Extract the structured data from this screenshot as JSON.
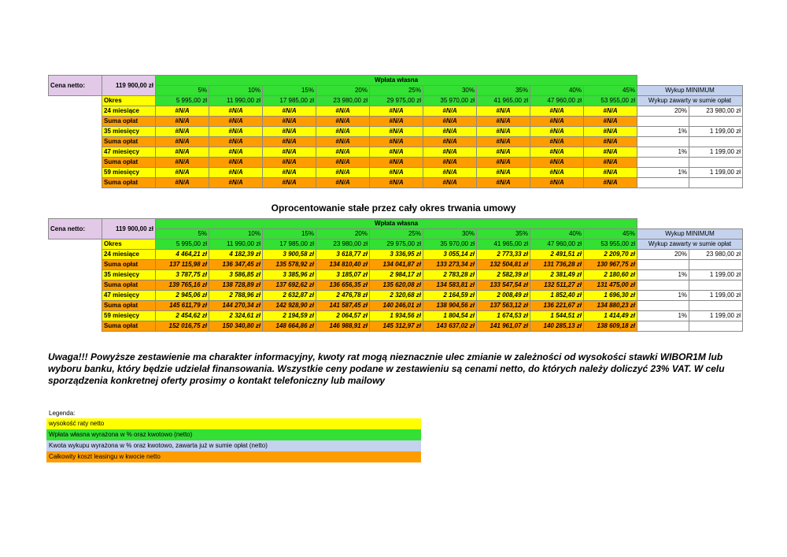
{
  "table1": {
    "cena_label": "Cena netto:",
    "cena_value": "119 900,00 zł",
    "wplata_title": "Wpłata własna",
    "percents": [
      "5%",
      "10%",
      "15%",
      "20%",
      "25%",
      "30%",
      "35%",
      "40%",
      "45%"
    ],
    "okres_label": "Okres",
    "amounts": [
      "5 995,00 zł",
      "11 990,00 zł",
      "17 985,00 zł",
      "23 980,00 zł",
      "29 975,00 zł",
      "35 970,00 zł",
      "41 965,00 zł",
      "47 960,00 zł",
      "53 955,00 zł"
    ],
    "wykup_title": "Wykup MINIMUM",
    "wykup_sub": "Wykup zawarty w sumie opłat",
    "rows": [
      {
        "label": "24 miesiące",
        "type": "rate",
        "cells": [
          "#N/A",
          "#N/A",
          "#N/A",
          "#N/A",
          "#N/A",
          "#N/A",
          "#N/A",
          "#N/A",
          "#N/A"
        ],
        "pct": "20%",
        "amt": "23 980,00 zł"
      },
      {
        "label": "Suma opłat",
        "type": "sum",
        "cells": [
          "#N/A",
          "#N/A",
          "#N/A",
          "#N/A",
          "#N/A",
          "#N/A",
          "#N/A",
          "#N/A",
          "#N/A"
        ],
        "pct": "",
        "amt": ""
      },
      {
        "label": "35 miesięcy",
        "type": "rate",
        "cells": [
          "#N/A",
          "#N/A",
          "#N/A",
          "#N/A",
          "#N/A",
          "#N/A",
          "#N/A",
          "#N/A",
          "#N/A"
        ],
        "pct": "1%",
        "amt": "1 199,00 zł"
      },
      {
        "label": "Suma opłat",
        "type": "sum",
        "cells": [
          "#N/A",
          "#N/A",
          "#N/A",
          "#N/A",
          "#N/A",
          "#N/A",
          "#N/A",
          "#N/A",
          "#N/A"
        ],
        "pct": "",
        "amt": ""
      },
      {
        "label": "47 miesięcy",
        "type": "rate",
        "cells": [
          "#N/A",
          "#N/A",
          "#N/A",
          "#N/A",
          "#N/A",
          "#N/A",
          "#N/A",
          "#N/A",
          "#N/A"
        ],
        "pct": "1%",
        "amt": "1 199,00 zł"
      },
      {
        "label": "Suma opłat",
        "type": "sum",
        "cells": [
          "#N/A",
          "#N/A",
          "#N/A",
          "#N/A",
          "#N/A",
          "#N/A",
          "#N/A",
          "#N/A",
          "#N/A"
        ],
        "pct": "",
        "amt": ""
      },
      {
        "label": "59 miesięcy",
        "type": "rate",
        "cells": [
          "#N/A",
          "#N/A",
          "#N/A",
          "#N/A",
          "#N/A",
          "#N/A",
          "#N/A",
          "#N/A",
          "#N/A"
        ],
        "pct": "1%",
        "amt": "1 199,00 zł"
      },
      {
        "label": "Suma opłat",
        "type": "sum",
        "cells": [
          "#N/A",
          "#N/A",
          "#N/A",
          "#N/A",
          "#N/A",
          "#N/A",
          "#N/A",
          "#N/A",
          "#N/A"
        ],
        "pct": "",
        "amt": ""
      }
    ]
  },
  "subtitle": "Oprocentowanie stałe przez cały okres trwania umowy",
  "table2": {
    "cena_label": "Cena netto:",
    "cena_value": "119 900,00 zł",
    "wplata_title": "Wpłata własna",
    "percents": [
      "5%",
      "10%",
      "15%",
      "20%",
      "25%",
      "30%",
      "35%",
      "40%",
      "45%"
    ],
    "okres_label": "Okres",
    "amounts": [
      "5 995,00 zł",
      "11 990,00 zł",
      "17 985,00 zł",
      "23 980,00 zł",
      "29 975,00 zł",
      "35 970,00 zł",
      "41 965,00 zł",
      "47 960,00 zł",
      "53 955,00 zł"
    ],
    "wykup_title": "Wykup MINIMUM",
    "wykup_sub": "Wykup zawarty w sumie opłat",
    "rows": [
      {
        "label": "24 miesiące",
        "type": "rate",
        "cells": [
          "4 464,21 zł",
          "4 182,39 zł",
          "3 900,58 zł",
          "3 618,77 zł",
          "3 336,95 zł",
          "3 055,14 zł",
          "2 773,33 zł",
          "2 491,51 zł",
          "2 209,70 zł"
        ],
        "pct": "20%",
        "amt": "23 980,00 zł"
      },
      {
        "label": "Suma opłat",
        "type": "sum",
        "cells": [
          "137 115,98 zł",
          "136 347,45 zł",
          "135 578,92 zł",
          "134 810,40 zł",
          "134 041,87 zł",
          "133 273,34 zł",
          "132 504,81 zł",
          "131 736,28 zł",
          "130 967,75 zł"
        ],
        "pct": "",
        "amt": ""
      },
      {
        "label": "35 miesięcy",
        "type": "rate",
        "cells": [
          "3 787,75 zł",
          "3 586,85 zł",
          "3 385,96 zł",
          "3 185,07 zł",
          "2 984,17 zł",
          "2 783,28 zł",
          "2 582,39 zł",
          "2 381,49 zł",
          "2 180,60 zł"
        ],
        "pct": "1%",
        "amt": "1 199,00 zł"
      },
      {
        "label": "Suma opłat",
        "type": "sum",
        "cells": [
          "139 765,16 zł",
          "138 728,89 zł",
          "137 692,62 zł",
          "136 656,35 zł",
          "135 620,08 zł",
          "134 583,81 zł",
          "133 547,54 zł",
          "132 511,27 zł",
          "131 475,00 zł"
        ],
        "pct": "",
        "amt": ""
      },
      {
        "label": "47 miesięcy",
        "type": "rate",
        "cells": [
          "2 945,06 zł",
          "2 788,96 zł",
          "2 632,87 zł",
          "2 476,78 zł",
          "2 320,68 zł",
          "2 164,59 zł",
          "2 008,49 zł",
          "1 852,40 zł",
          "1 696,30 zł"
        ],
        "pct": "1%",
        "amt": "1 199,00 zł"
      },
      {
        "label": "Suma opłat",
        "type": "sum",
        "cells": [
          "145 611,79 zł",
          "144 270,34 zł",
          "142 928,90 zł",
          "141 587,45 zł",
          "140 246,01 zł",
          "138 904,56 zł",
          "137 563,12 zł",
          "136 221,67 zł",
          "134 880,23 zł"
        ],
        "pct": "",
        "amt": ""
      },
      {
        "label": "59 miesięcy",
        "type": "rate",
        "cells": [
          "2 454,62 zł",
          "2 324,61 zł",
          "2 194,59 zł",
          "2 064,57 zł",
          "1 934,56 zł",
          "1 804,54 zł",
          "1 674,53 zł",
          "1 544,51 zł",
          "1 414,49 zł"
        ],
        "pct": "1%",
        "amt": "1 199,00 zł"
      },
      {
        "label": "Suma opłat",
        "type": "sum",
        "cells": [
          "152 016,75 zł",
          "150 340,80 zł",
          "148 664,86 zł",
          "146 988,91 zł",
          "145 312,97 zł",
          "143 637,02 zł",
          "141 961,07 zł",
          "140 285,13 zł",
          "138 609,18 zł"
        ],
        "pct": "",
        "amt": ""
      }
    ]
  },
  "note": "Uwaga!!! Powyższe zestawienie ma charakter informacyjny, kwoty rat mogą nieznacznie ulec zmianie w zależności od wysokości stawki WIBOR1M lub wyboru banku, który będzie udzielał finansowania. Wszystkie ceny podane w zestawieniu są cenami netto, do których należy doliczyć 23% VAT. W celu sporządzenia konkretnej oferty prosimy o kontakt telefoniczny lub mailowy",
  "legend": {
    "title": "Legenda:",
    "items": [
      {
        "text": "wysokość raty netto",
        "color": "#ffff00"
      },
      {
        "text": "Wpłata własna wyrażona w % oraz kwotowo (netto)",
        "color": "#33e033"
      },
      {
        "text": "Kwota wykupu wyrażona w % oraz kwotowo, zawarta już w sumie opłat (netto)",
        "color": "#c4d2ee"
      },
      {
        "text": "Całkowity koszt leasingu w kwocie netto",
        "color": "#ff9d00"
      }
    ]
  }
}
